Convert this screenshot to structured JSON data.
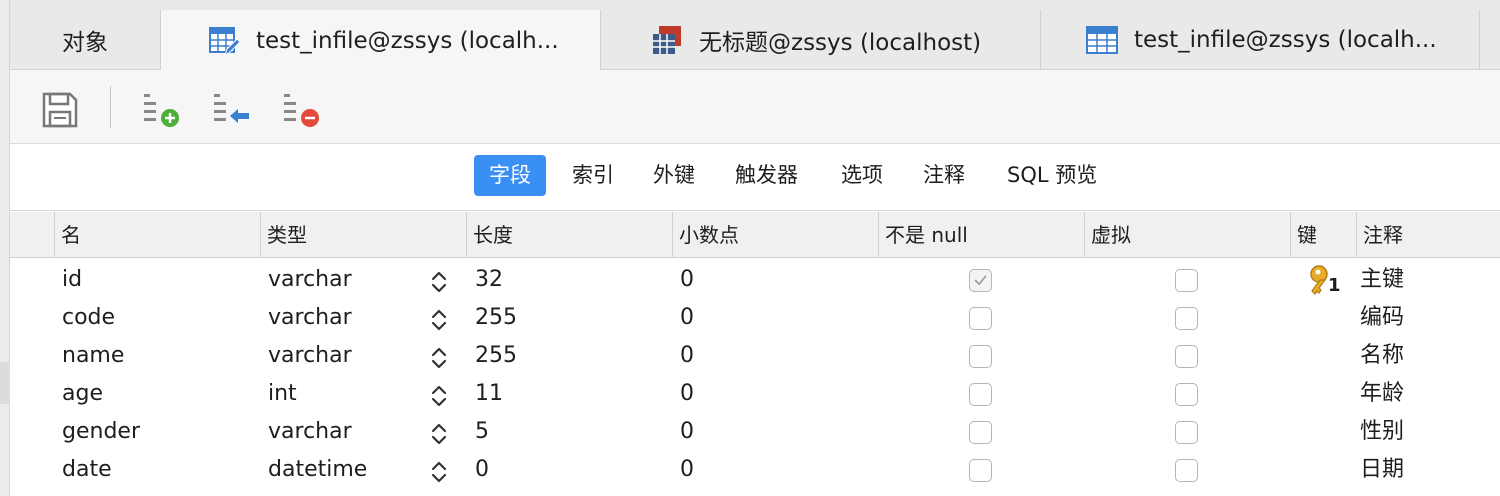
{
  "tabs": [
    {
      "label": "对象",
      "icon": "none"
    },
    {
      "label": "test_infile@zssys (localh...",
      "icon": "table-edit-icon",
      "active": true
    },
    {
      "label": "无标题@zssys (localhost)",
      "icon": "table-query-icon"
    },
    {
      "label": "test_infile@zssys (localh...",
      "icon": "table-icon"
    }
  ],
  "toolbar": {
    "buttons": [
      {
        "name": "save-icon"
      },
      {
        "name": "add-field-icon"
      },
      {
        "name": "insert-field-icon"
      },
      {
        "name": "delete-field-icon"
      }
    ]
  },
  "subtabs": [
    "字段",
    "索引",
    "外键",
    "触发器",
    "选项",
    "注释",
    "SQL 预览"
  ],
  "columns": {
    "name": "名",
    "type": "类型",
    "length": "长度",
    "decimals": "小数点",
    "not_null": "不是 null",
    "virtual": "虚拟",
    "key": "键",
    "comment": "注释"
  },
  "rows": [
    {
      "name": "id",
      "type": "varchar",
      "length": "32",
      "decimals": "0",
      "not_null": true,
      "virtual": false,
      "key": "1",
      "comment": "主键"
    },
    {
      "name": "code",
      "type": "varchar",
      "length": "255",
      "decimals": "0",
      "not_null": false,
      "virtual": false,
      "key": "",
      "comment": "编码"
    },
    {
      "name": "name",
      "type": "varchar",
      "length": "255",
      "decimals": "0",
      "not_null": false,
      "virtual": false,
      "key": "",
      "comment": "名称"
    },
    {
      "name": "age",
      "type": "int",
      "length": "11",
      "decimals": "0",
      "not_null": false,
      "virtual": false,
      "key": "",
      "comment": "年龄"
    },
    {
      "name": "gender",
      "type": "varchar",
      "length": "5",
      "decimals": "0",
      "not_null": false,
      "virtual": false,
      "key": "",
      "comment": "性别"
    },
    {
      "name": "date",
      "type": "datetime",
      "length": "0",
      "decimals": "0",
      "not_null": false,
      "virtual": false,
      "key": "",
      "comment": "日期"
    }
  ],
  "colors": {
    "accent": "#3a8ff5",
    "key": "#e0a21a",
    "add": "#4caf3a",
    "delete": "#e24a3b",
    "insert": "#3a7fd0"
  }
}
